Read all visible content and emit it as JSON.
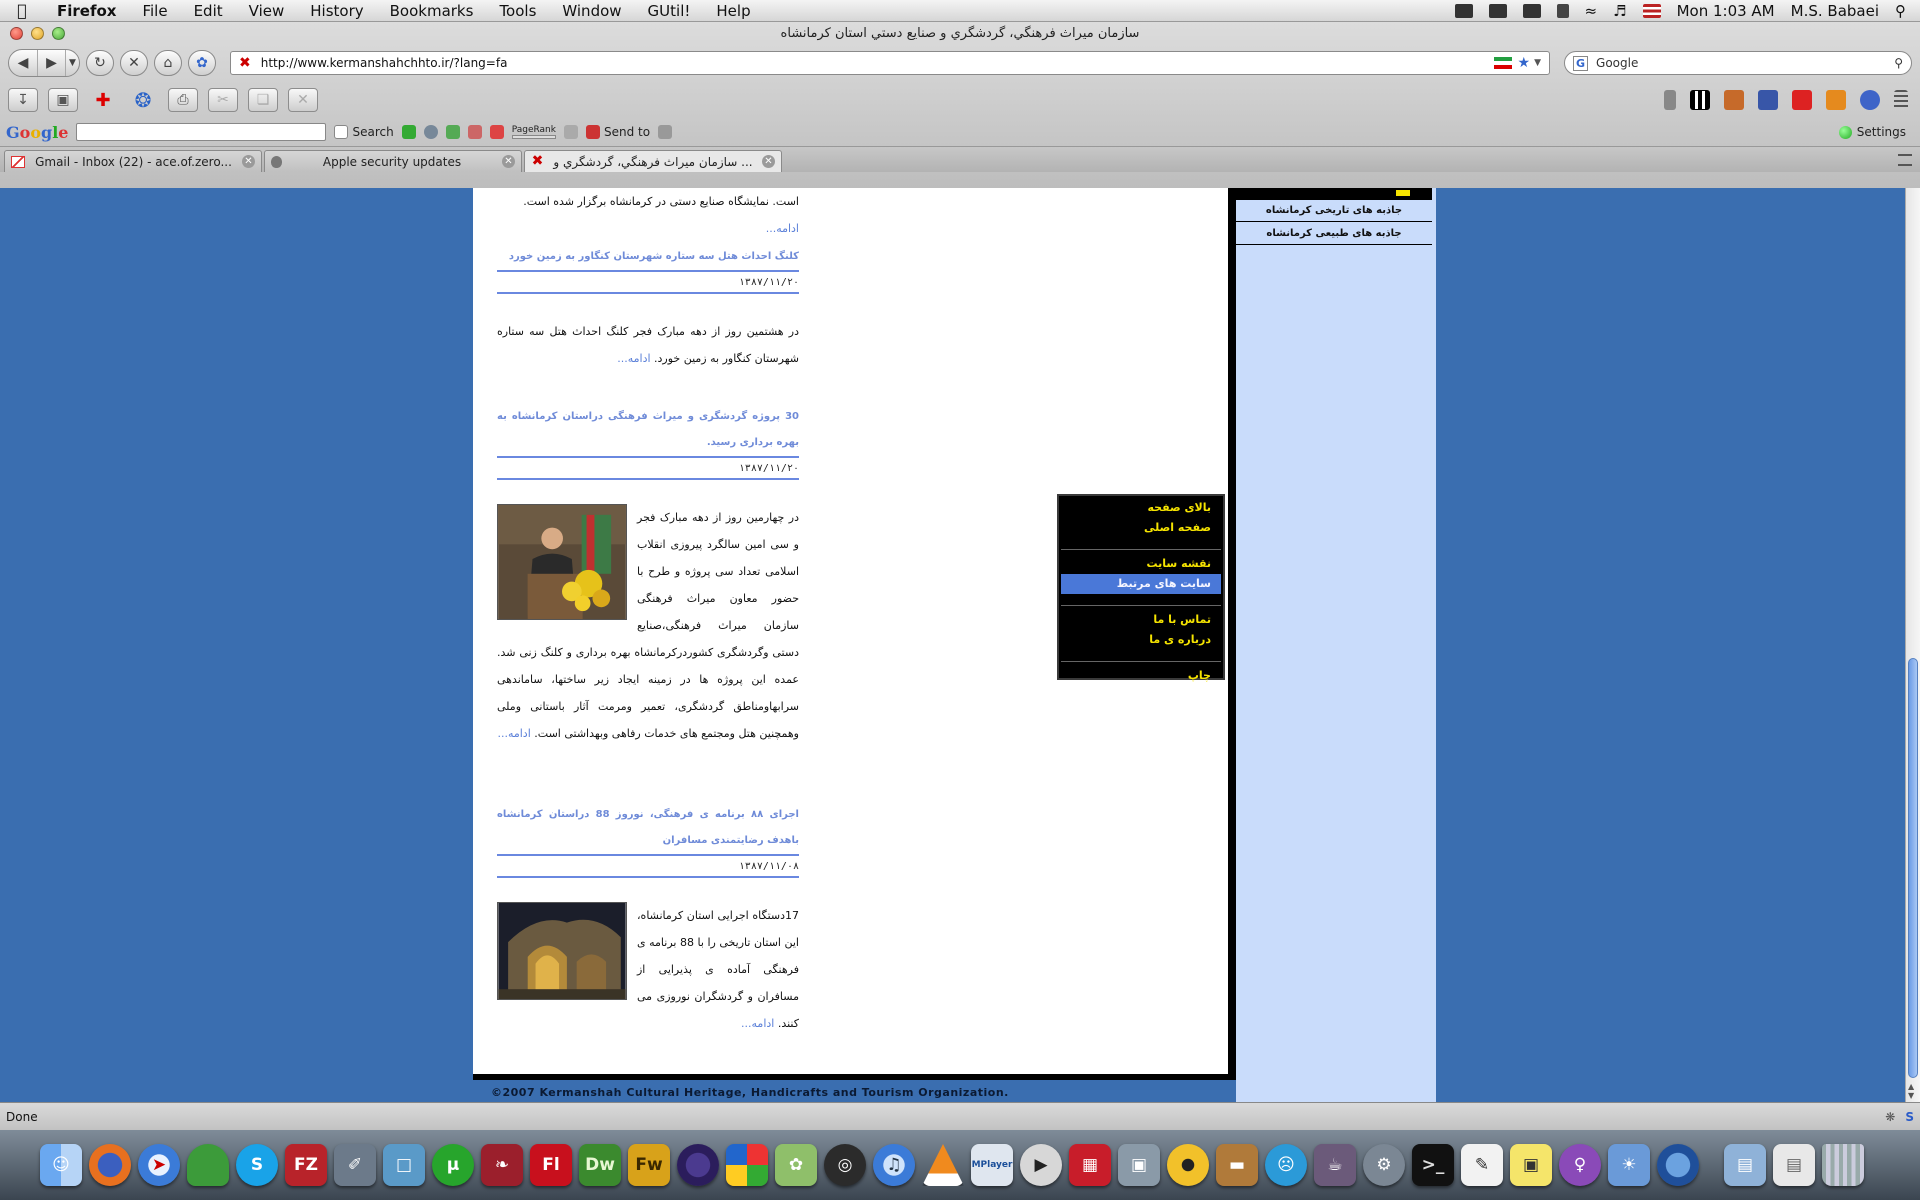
{
  "menubar": {
    "app": "Firefox",
    "menus": [
      "File",
      "Edit",
      "View",
      "History",
      "Bookmarks",
      "Tools",
      "Window",
      "GUtil!",
      "Help"
    ],
    "clock": "Mon 1:03 AM",
    "user": "M.S. Babaei"
  },
  "window": {
    "title": "سازمان ميراث فرهنگي، گردشگري و صنايع دستي استان كرمانشاه"
  },
  "navbar": {
    "url": "http://www.kermanshahchhto.ir/?lang=fa",
    "search_value": "Google"
  },
  "googlebar": {
    "logo": [
      "G",
      "o",
      "o",
      "g",
      "l",
      "e"
    ],
    "search_label": "Search",
    "pagerank_label": "PageRank",
    "sendto_label": "Send to",
    "settings_label": "Settings"
  },
  "tabs": [
    {
      "label": "Gmail - Inbox (22) - ace.of.zero...",
      "active": false
    },
    {
      "label": "Apple security updates",
      "active": false
    },
    {
      "label": "سازمان ميراث فرهنگي، گردشگري و ...",
      "active": true
    }
  ],
  "page": {
    "intro": {
      "body": "است. نمایشگاه صنایع دستی در کرمانشاه برگزار شده است.",
      "more": "ادامه..."
    },
    "news": [
      {
        "headline": "کلنگ احداث هتل سه ستاره شهرستان کنگاور به زمین خورد",
        "date": "۱۳۸۷/۱۱/۲۰",
        "body": "در هشتمین روز از دهه مبارک فجر کلنگ احداث هتل سه ستاره شهرستان کنگاور به زمین خورد.",
        "more": "ادامه..."
      },
      {
        "headline": "30 پروژه گردشگری و میراث فرهنگی دراستان کرمانشاه به بهره برداری رسید.",
        "date": "۱۳۸۷/۱۱/۲۰",
        "body": "در چهارمین روز از دهه مبارک فجر و سی امین سالگرد پیروزی انقلاب اسلامی تعداد سی پروژه و طرح با حضور معاون میراث فرهنگی سازمان میراث فرهنگی،صنایع دستی وگردشگری کشوردرکرمانشاه بهره برداری و کلنگ زنی شد. عمده این پروژه ها در زمینه ایجاد زیر ساختها، ساماندهی سرابهاومناطق گردشگری، تعمیر ومرمت آثار باستانی وملی وهمچنین هتل ومجتمع های خدمات رفاهی وبهداشتی است.",
        "more": "ادامه..."
      },
      {
        "headline": "اجرای ۸۸ برنامه ی فرهنگی، نوروز 88 دراستان کرمانشاه باهدف رضایتمندی مسافران",
        "date": "۱۳۸۷/۱۱/۰۸",
        "body": "17دستگاه اجرایی استان کرمانشاه، این استان تاریخی را با 88 برنامه ی فرهنگی آماده ی پذیرایی از مسافران و گردشگران نوروزی می کنند.",
        "more": "ادامه..."
      }
    ],
    "footer": "©2007 Kermanshah Cultural Heritage, Handicrafts and Tourism Organization."
  },
  "sidebar": {
    "links": [
      "جاذبه های تاریخی کرمانشاه",
      "جاذبه های طبیعی کرمانشاه"
    ]
  },
  "quickmenu": {
    "groups": [
      [
        "بالای صفحه",
        "صفحه اصلی"
      ],
      [
        "نقشه سایت",
        "سایت های مرتبط"
      ],
      [
        "تماس با ما",
        "درباره ی ما"
      ],
      [
        "چاپ"
      ]
    ],
    "selected": "سایت های مرتبط",
    "text_color": "#f5e300",
    "selected_bg": "#4a78d8"
  },
  "statusbar": {
    "text": "Done"
  },
  "dock": {
    "labels": [
      "Fl",
      "Dw",
      "Fw",
      "MPlayer"
    ]
  },
  "colors": {
    "page_bg": "#3a6eb0",
    "sidebar_bg": "#c9dcfb",
    "headline": "#6f8bd8",
    "link": "#5a7fd8"
  }
}
